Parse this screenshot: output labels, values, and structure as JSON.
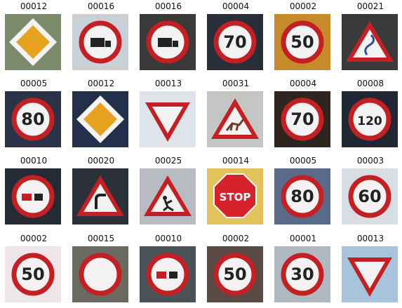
{
  "grid": {
    "rows": 4,
    "cols": 6,
    "cells": [
      {
        "label": "00012",
        "sign": "priority-road",
        "bg": "#7a8a6a",
        "text": ""
      },
      {
        "label": "00016",
        "sign": "no-trucks",
        "bg": "#c9d0d6",
        "text": ""
      },
      {
        "label": "00016",
        "sign": "no-trucks",
        "bg": "#3b3a38",
        "text": ""
      },
      {
        "label": "00004",
        "sign": "speed-limit",
        "bg": "#2a2e38",
        "text": "70"
      },
      {
        "label": "00002",
        "sign": "speed-limit",
        "bg": "#c78a2a",
        "text": "50"
      },
      {
        "label": "00021",
        "sign": "double-curve",
        "bg": "#3a3a3a",
        "text": ""
      },
      {
        "label": "00005",
        "sign": "speed-limit",
        "bg": "#2a3348",
        "text": "80"
      },
      {
        "label": "00012",
        "sign": "priority-road",
        "bg": "#22304a",
        "text": ""
      },
      {
        "label": "00013",
        "sign": "yield",
        "bg": "#dfe4ea",
        "text": ""
      },
      {
        "label": "00031",
        "sign": "wild-animals",
        "bg": "#c4c6c4",
        "text": ""
      },
      {
        "label": "00004",
        "sign": "speed-limit",
        "bg": "#2e2420",
        "text": "70"
      },
      {
        "label": "00008",
        "sign": "speed-limit",
        "bg": "#202634",
        "text": "120"
      },
      {
        "label": "00010",
        "sign": "no-overtaking-trucks",
        "bg": "#262a34",
        "text": ""
      },
      {
        "label": "00020",
        "sign": "curve-right",
        "bg": "#2c3038",
        "text": ""
      },
      {
        "label": "00025",
        "sign": "road-work",
        "bg": "#b8bcc0",
        "text": ""
      },
      {
        "label": "00014",
        "sign": "stop",
        "bg": "#e2c25a",
        "text": "STOP"
      },
      {
        "label": "00005",
        "sign": "speed-limit",
        "bg": "#5a6a8a",
        "text": "80"
      },
      {
        "label": "00003",
        "sign": "speed-limit",
        "bg": "#d8dde2",
        "text": "60"
      },
      {
        "label": "00002",
        "sign": "speed-limit",
        "bg": "#ece6ea",
        "text": "50"
      },
      {
        "label": "00015",
        "sign": "no-vehicles",
        "bg": "#6a6a62",
        "text": ""
      },
      {
        "label": "00010",
        "sign": "no-overtaking-trucks",
        "bg": "#4a5258",
        "text": ""
      },
      {
        "label": "00002",
        "sign": "speed-limit",
        "bg": "#5a4a44",
        "text": "50"
      },
      {
        "label": "00001",
        "sign": "speed-limit",
        "bg": "#b0b8c0",
        "text": "30"
      },
      {
        "label": "00013",
        "sign": "yield",
        "bg": "#a8c4dc",
        "text": ""
      }
    ]
  }
}
